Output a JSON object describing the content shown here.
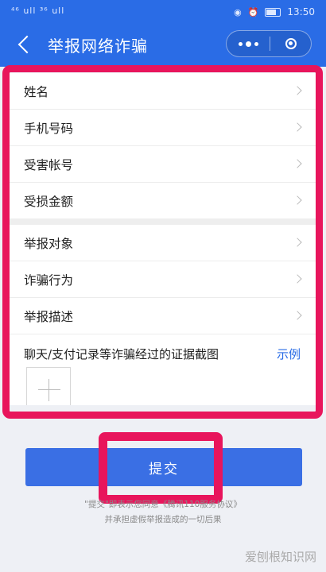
{
  "status_bar": {
    "left_text": "⁴⁶ ull ³⁶ ull",
    "time": "13:50"
  },
  "header": {
    "title": "举报网络诈骗",
    "back_icon": "chevron-left-icon",
    "more_icon": "more-dots-icon",
    "close_icon": "target-ring-icon"
  },
  "form": {
    "group1": [
      {
        "label": "姓名"
      },
      {
        "label": "手机号码"
      },
      {
        "label": "受害帐号"
      },
      {
        "label": "受损金额"
      }
    ],
    "group2": [
      {
        "label": "举报对象"
      },
      {
        "label": "诈骗行为"
      },
      {
        "label": "举报描述"
      }
    ],
    "evidence": {
      "label": "聊天/支付记录等诈骗经过的证据截图",
      "example_label": "示例",
      "upload_icon": "plus-icon"
    }
  },
  "submit": {
    "label": "提交"
  },
  "agreement": {
    "line1": "\"提交\"即表示您同意《腾讯110服务协议》",
    "line2": "并承担虚假举报造成的一切后果"
  },
  "watermark": {
    "text": "爱刨根知识网"
  },
  "colors": {
    "header_blue": "#2a6ce6",
    "button_blue": "#3a6fe4",
    "highlight_red": "#e8155c",
    "link_blue": "#2a6ce6"
  }
}
